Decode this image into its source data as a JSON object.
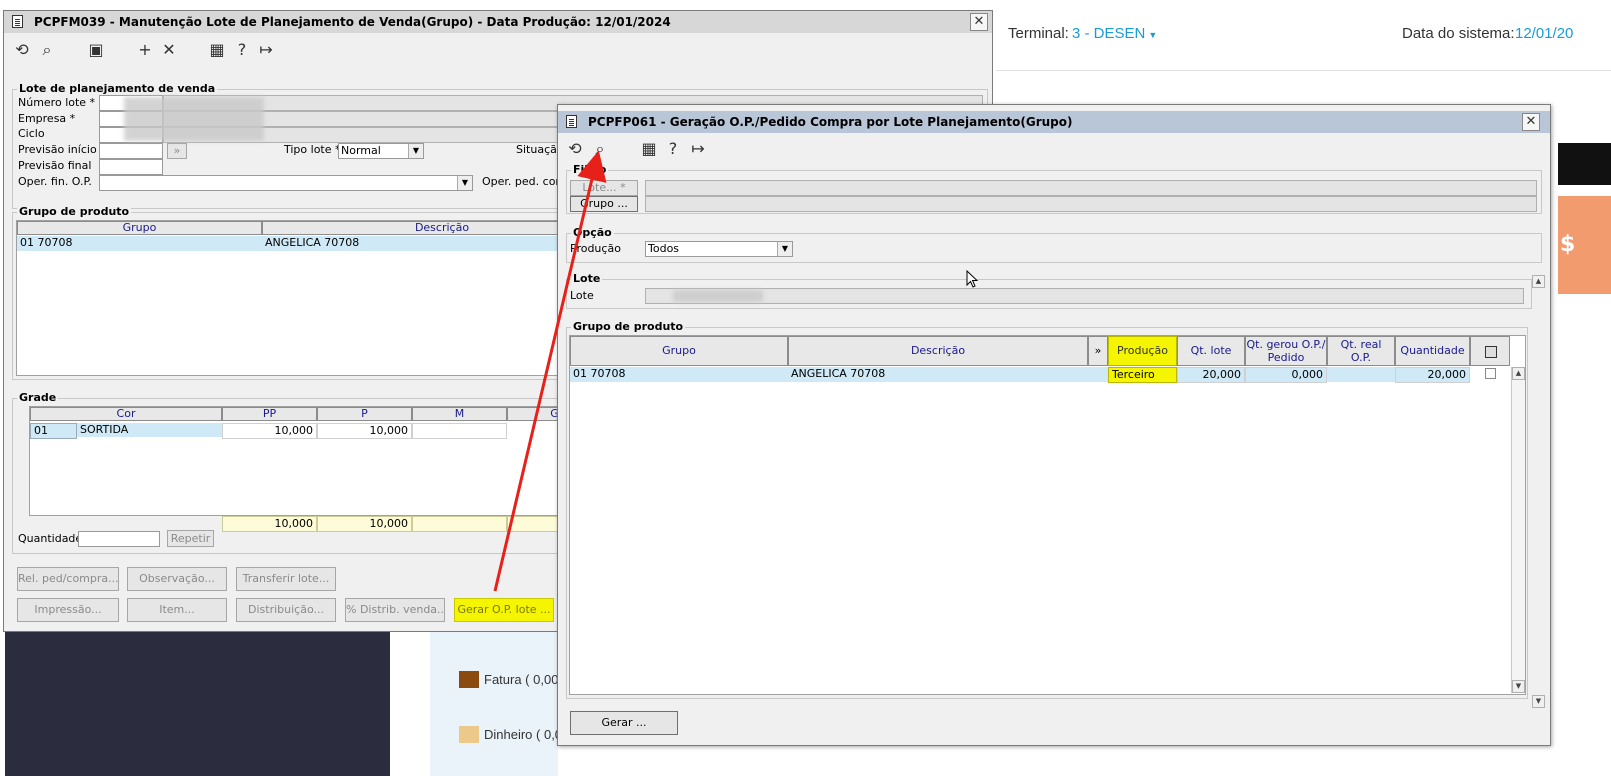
{
  "back_window": {
    "title": "PCPFM039 - Manutenção Lote de Planejamento de Venda(Grupo) - Data Produção: 12/01/2024",
    "close_glyph": "✕",
    "group_lote": "Lote de planejamento de venda",
    "labels": {
      "numero_lote": "Número lote *",
      "empresa": "Empresa *",
      "ciclo": "Ciclo",
      "previsao_inicio": "Previsão início",
      "previsao_final": "Previsão final",
      "oper_fin_op": "Oper. fin. O.P.",
      "tipo_lote": "Tipo lote *",
      "situacao": "Situação",
      "oper_ped_comp": "Oper. ped. comp"
    },
    "tipo_lote_value": "Normal",
    "group_produto": "Grupo de produto",
    "produto_columns": [
      "Grupo",
      "Descrição"
    ],
    "produto_row": {
      "grupo": "01 70708",
      "descricao": "ANGELICA 70708"
    },
    "group_grade": "Grade",
    "grade_columns": [
      "Cor",
      "PP",
      "P",
      "M",
      "G"
    ],
    "grade_row": {
      "code": "01",
      "cor": "SORTIDA",
      "pp": "10,000",
      "p": "10,000"
    },
    "grade_totals": {
      "pp": "10,000",
      "p": "10,000"
    },
    "quantidade_label": "Quantidade",
    "repetir_label": "Repetir",
    "buttons_row1": [
      "Rel. ped/compra...",
      "Observação...",
      "Transferir lote..."
    ],
    "buttons_row2": [
      "Impressão...",
      "Item...",
      "Distribuição...",
      "% Distrib. venda...",
      "Gerar O.P. lote ..."
    ]
  },
  "right_panel": {
    "terminal_label": "Terminal:",
    "terminal_value": "3 - DESEN",
    "system_date_label": "Data do sistema:",
    "system_date_value": "12/01/20",
    "legend": [
      {
        "label": "Fatura ( 0,00",
        "color": "#8b4a0e"
      },
      {
        "label": "Dinheiro ( 0,0",
        "color": "#ecc88a"
      }
    ],
    "side_icon_glyph": "$"
  },
  "front_window": {
    "title": "PCPFP061 - Geração O.P./Pedido Compra por Lote Planejamento(Grupo)",
    "close_glyph": "✕",
    "group_filtro": "Filtro",
    "lote_button": "Lote... *",
    "grupo_button": "Grupo ...",
    "group_opcao": "Opção",
    "producao_label": "Produção",
    "producao_value": "Todos",
    "group_lote": "Lote",
    "lote_label": "Lote",
    "group_produto": "Grupo de produto",
    "columns": {
      "grupo": "Grupo",
      "descricao": "Descrição",
      "expand": "»",
      "producao": "Produção",
      "qt_lote": "Qt. lote",
      "qt_gerou_1": "Qt. gerou O.P./",
      "qt_gerou_2": "Pedido compra",
      "qt_real_1": "Qt. real",
      "qt_real_2": "O.P.",
      "quantidade": "Quantidade"
    },
    "row": {
      "grupo": "01 70708",
      "descricao": "ANGELICA 70708",
      "producao": "Terceiro",
      "qt_lote": "20,000",
      "qt_gerou": "0,000",
      "qt_real": "",
      "quantidade": "20,000"
    },
    "gerar_button": "Gerar ..."
  },
  "colors": {
    "highlight": "#f5f500",
    "arrow": "#e8201a",
    "row_selected": "#cfe9f7",
    "titlebar_back": "#d7d7d7",
    "titlebar_front": "#b9c6d8"
  }
}
